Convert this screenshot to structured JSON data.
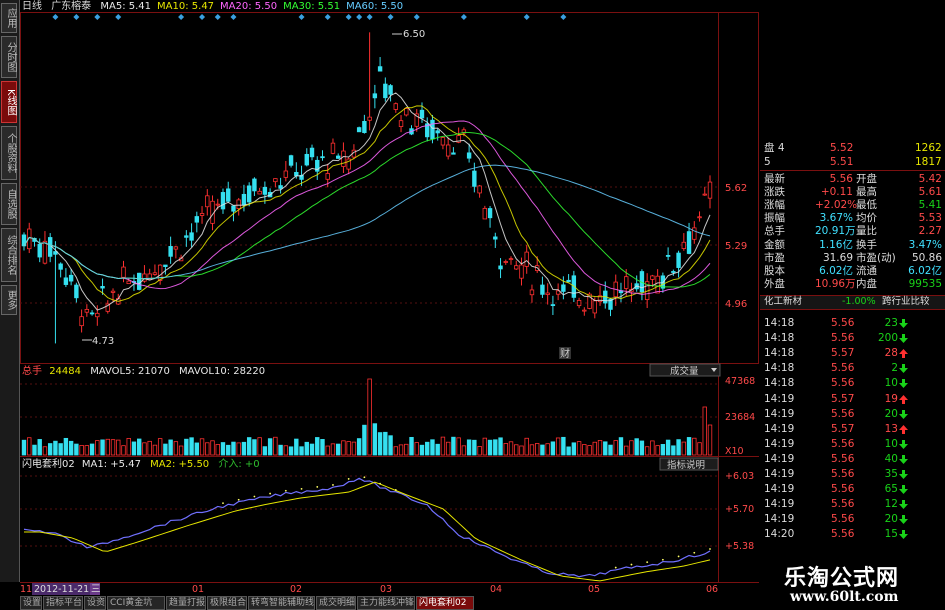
{
  "header": {
    "period": "日线",
    "stock_name": "广东榕泰",
    "ma_labels": [
      {
        "text": "MA5: 5.41",
        "color": "#e8e8e8"
      },
      {
        "text": "MA10: 5.47",
        "color": "#e6e600"
      },
      {
        "text": "MA20: 5.50",
        "color": "#ff66ff"
      },
      {
        "text": "MA30: 5.51",
        "color": "#33ff33"
      },
      {
        "text": "MA60: 5.50",
        "color": "#66ccff"
      }
    ]
  },
  "left_toolbar": [
    {
      "label": "应用",
      "active": false
    },
    {
      "label": "分时图",
      "active": false
    },
    {
      "label": "K线图",
      "active": true
    },
    {
      "label": "个股资料",
      "active": false
    },
    {
      "label": "自选股",
      "active": false
    },
    {
      "label": "综合排名",
      "active": false
    },
    {
      "label": "更多",
      "active": false
    }
  ],
  "price_panel": {
    "y_ticks": [
      "5.62",
      "5.29",
      "4.96"
    ],
    "high_label": "6.50",
    "low_label": "4.73",
    "cai_marker": "财"
  },
  "volume_panel": {
    "title": "总手",
    "value": "24484",
    "mavol5": "MAVOL5: 21070",
    "mavol10": "MAVOL10: 28220",
    "dropdown": "成交量",
    "y_ticks": [
      "47368",
      "23684",
      "X10"
    ]
  },
  "indicator_panel": {
    "name": "闪电套利02",
    "ma1": "MA1: +5.47",
    "ma2": "MA2: +5.50",
    "extra": "介入: +0",
    "button": "指标说明",
    "y_ticks": [
      "+6.03",
      "+5.70",
      "+5.38"
    ]
  },
  "x_axis": {
    "prefix": "11",
    "date_badge": "2012-11-21",
    "day_badge": "三",
    "months": [
      "01",
      "02",
      "03",
      "04",
      "05",
      "06"
    ]
  },
  "quote": {
    "ask_rows": [
      {
        "label": "盘 4",
        "price": "5.52",
        "vol": "1262"
      },
      {
        "label": "5",
        "price": "5.51",
        "vol": "1817"
      }
    ],
    "stats": [
      {
        "l1": "最新",
        "v1": "5.56",
        "c1": "red",
        "l2": "开盘",
        "v2": "5.42",
        "c2": "red"
      },
      {
        "l1": "涨跌",
        "v1": "+0.11",
        "c1": "red",
        "l2": "最高",
        "v2": "5.61",
        "c2": "red"
      },
      {
        "l1": "涨幅",
        "v1": "+2.02%",
        "c1": "red",
        "l2": "最低",
        "v2": "5.41",
        "c2": "grn"
      },
      {
        "l1": "振幅",
        "v1": "3.67%",
        "c1": "cyan",
        "l2": "均价",
        "v2": "5.53",
        "c2": "red"
      },
      {
        "l1": "总手",
        "v1": "20.91万",
        "c1": "cyan",
        "l2": "量比",
        "v2": "2.27",
        "c2": "red"
      },
      {
        "l1": "金额",
        "v1": "1.16亿",
        "c1": "cyan",
        "l2": "换手",
        "v2": "3.47%",
        "c2": "cyan"
      },
      {
        "l1": "市盈",
        "v1": "31.69",
        "c1": "wht",
        "l2": "市盈(动)",
        "v2": "50.86",
        "c2": "wht"
      },
      {
        "l1": "股本",
        "v1": "6.02亿",
        "c1": "cyan",
        "l2": "流通",
        "v2": "6.02亿",
        "c2": "cyan"
      },
      {
        "l1": "外盘",
        "v1": "10.96万",
        "c1": "red",
        "l2": "内盘",
        "v2": "99535",
        "c2": "grn"
      }
    ],
    "sector": {
      "name": "化工新材",
      "change": "-1.00%",
      "button": "跨行业比较"
    },
    "ticks": [
      {
        "time": "14:18",
        "price": "5.56",
        "vol": "23",
        "dir": "down"
      },
      {
        "time": "14:18",
        "price": "5.56",
        "vol": "200",
        "dir": "down"
      },
      {
        "time": "14:18",
        "price": "5.57",
        "vol": "28",
        "dir": "up"
      },
      {
        "time": "14:18",
        "price": "5.56",
        "vol": "2",
        "dir": "down"
      },
      {
        "time": "14:18",
        "price": "5.56",
        "vol": "10",
        "dir": "down"
      },
      {
        "time": "14:19",
        "price": "5.57",
        "vol": "19",
        "dir": "up"
      },
      {
        "time": "14:19",
        "price": "5.56",
        "vol": "20",
        "dir": "down"
      },
      {
        "time": "14:19",
        "price": "5.57",
        "vol": "13",
        "dir": "up"
      },
      {
        "time": "14:19",
        "price": "5.56",
        "vol": "10",
        "dir": "down"
      },
      {
        "time": "14:19",
        "price": "5.56",
        "vol": "40",
        "dir": "down"
      },
      {
        "time": "14:19",
        "price": "5.56",
        "vol": "35",
        "dir": "down"
      },
      {
        "time": "14:19",
        "price": "5.56",
        "vol": "65",
        "dir": "down"
      },
      {
        "time": "14:19",
        "price": "5.56",
        "vol": "12",
        "dir": "down"
      },
      {
        "time": "14:19",
        "price": "5.56",
        "vol": "20",
        "dir": "down"
      },
      {
        "time": "14:20",
        "price": "5.56",
        "vol": "15",
        "dir": "down"
      }
    ]
  },
  "bottom_tabs": [
    {
      "label": "设置",
      "active": false
    },
    {
      "label": "指标平台",
      "active": false
    },
    {
      "label": "设资",
      "active": false
    },
    {
      "label": "CCI黄金坑",
      "active": false
    },
    {
      "label": "趋量打报",
      "active": false
    },
    {
      "label": "极限组合",
      "active": false
    },
    {
      "label": "转弯智能辅助线",
      "active": false
    },
    {
      "label": "成交明细",
      "active": false
    },
    {
      "label": "主力能线冲锋",
      "active": false
    },
    {
      "label": "闪电套利02",
      "active": true
    }
  ],
  "watermark": {
    "title": "乐淘公式网",
    "url": "www.60lt.com"
  },
  "colors": {
    "up": "#ff3030",
    "down": "#35e0f0",
    "accent": "#ff4a4a",
    "green": "#19d219"
  }
}
